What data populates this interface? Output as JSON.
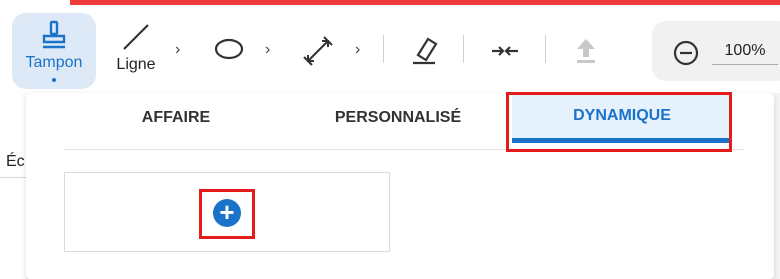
{
  "toolbar": {
    "tampon_label": "Tampon",
    "ligne_label": "Ligne",
    "zoom_value": "100%",
    "chevron": "›"
  },
  "left_edge_text": "Éc",
  "tabs": [
    {
      "label": "AFFAIRE"
    },
    {
      "label": "PERSONNALISÉ"
    },
    {
      "label": "DYNAMIQUE",
      "active": true
    }
  ],
  "add_button": "+",
  "colors": {
    "accent": "#1a73c8",
    "highlight": "#e51c1c",
    "top_bar": "#ef3b3b"
  }
}
